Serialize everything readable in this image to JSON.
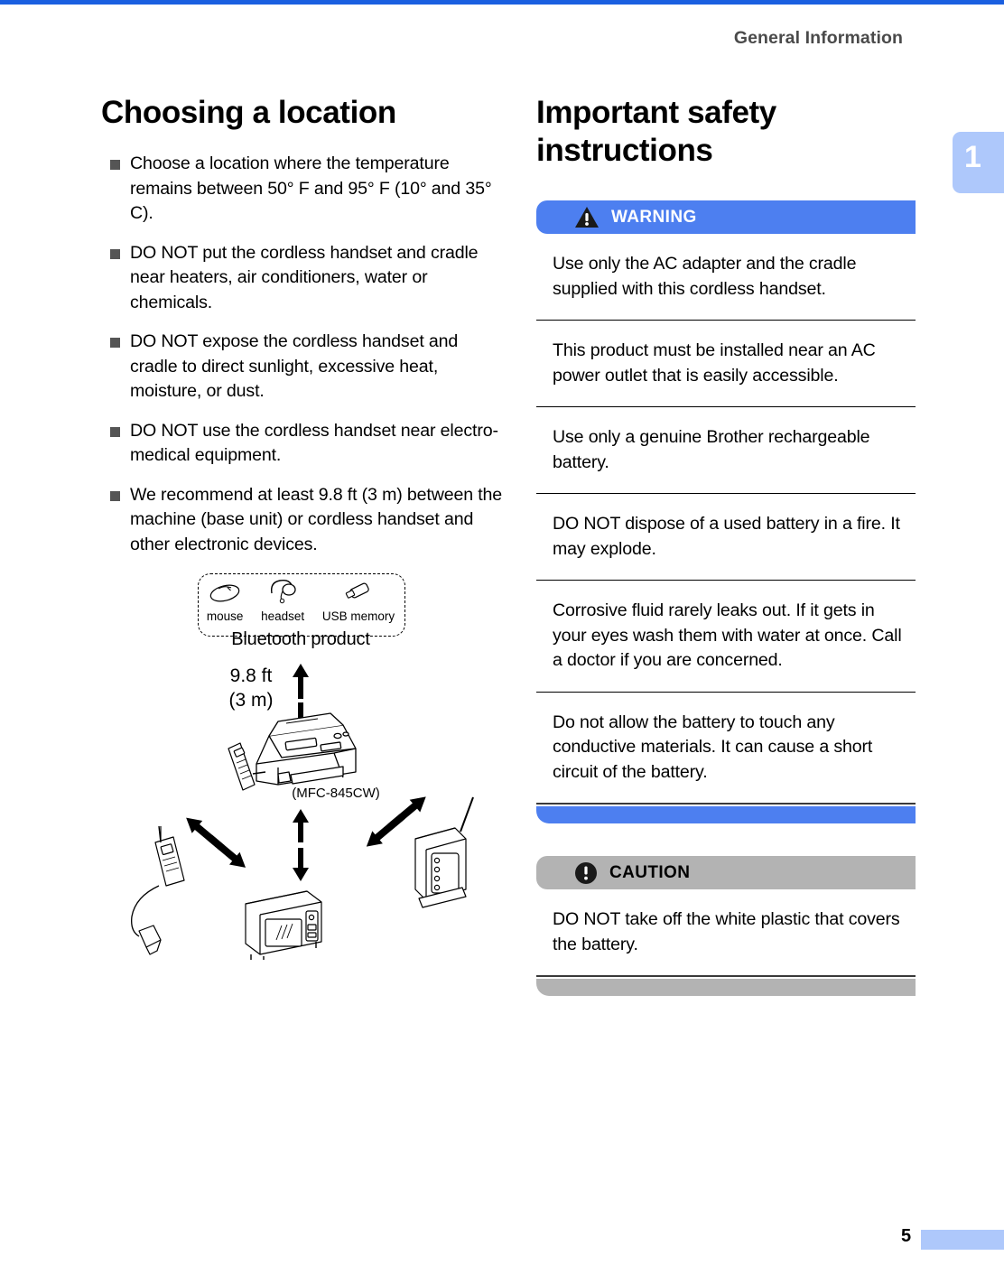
{
  "page": {
    "running_head": "General Information",
    "chapter_tab": "1",
    "folio": "5",
    "accent_blue": "#1a5fe0",
    "tab_blue": "#aec8fb",
    "warning_blue": "#4d7ff0",
    "caution_gray": "#b3b3b3"
  },
  "left_column": {
    "title": "Choosing a location",
    "bullets": [
      "Choose a location where the temperature remains between 50° F and 95° F (10° and 35° C).",
      "DO NOT put the cordless handset and cradle near heaters, air conditioners, water or chemicals.",
      "DO NOT expose the cordless handset and cradle to direct sunlight, excessive heat, moisture, or dust.",
      "DO NOT use the cordless handset near electro-medical equipment.",
      "We recommend at least 9.8 ft (3 m) between the machine (base unit) or cordless handset and other electronic devices."
    ]
  },
  "figure": {
    "bluetooth_items": [
      {
        "icon": "mouse-icon",
        "label": "mouse"
      },
      {
        "icon": "headset-icon",
        "label": "headset"
      },
      {
        "icon": "usb-memory-icon",
        "label": "USB memory"
      }
    ],
    "bluetooth_caption": "Bluetooth product",
    "distance_line1": "9.8 ft",
    "distance_line2": "(3 m)",
    "machine_label": "(MFC-845CW)",
    "devices": [
      {
        "icon": "cordless-phone-icon",
        "position": "left"
      },
      {
        "icon": "wireless-router-icon",
        "position": "right"
      },
      {
        "icon": "microwave-oven-icon",
        "position": "bottom"
      }
    ]
  },
  "right_column": {
    "title": "Important safety instructions",
    "warning": {
      "icon": "warning-triangle-icon",
      "label": "WARNING",
      "items": [
        "Use only the AC adapter and the cradle supplied with this cordless handset.",
        "This product must be installed near an AC power outlet that is easily accessible.",
        "Use only a genuine Brother rechargeable battery.",
        "DO NOT dispose of a used battery in a fire. It may explode.",
        "Corrosive fluid rarely leaks out. If it gets in your eyes wash them with water at once. Call a doctor if you are concerned.",
        "Do not allow the battery to touch any conductive materials. It can cause a short circuit of the battery."
      ]
    },
    "caution": {
      "icon": "caution-circle-icon",
      "label": "CAUTION",
      "items": [
        "DO NOT take off the white plastic that covers the battery."
      ]
    }
  }
}
